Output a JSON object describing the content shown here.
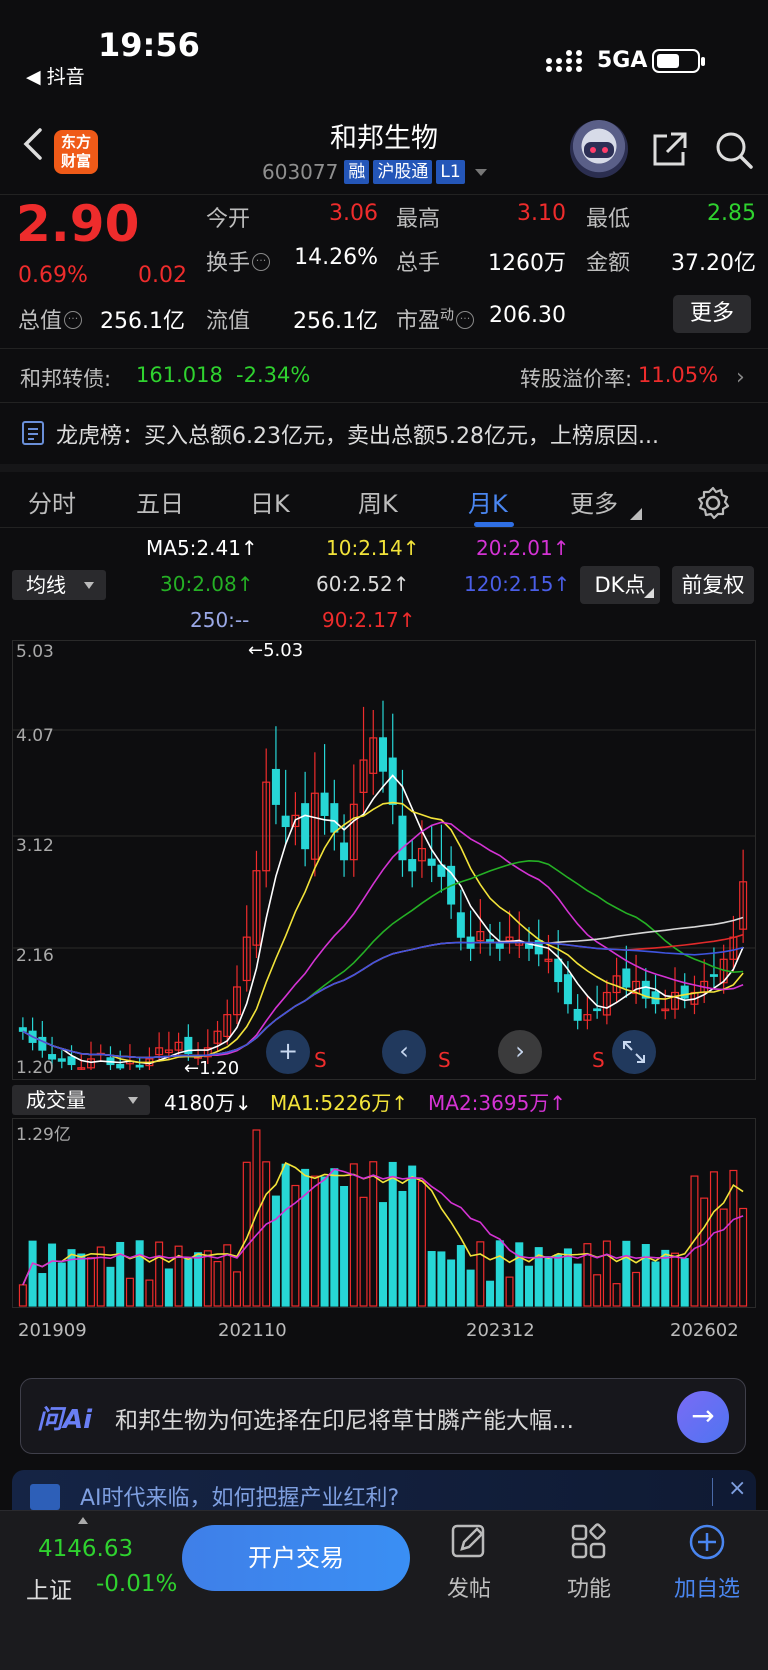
{
  "status_bar": {
    "time": "19:56",
    "back_app": "◀ 抖音",
    "network": "5GA"
  },
  "header": {
    "brand_logo": "东方财富",
    "stock_name": "和邦生物",
    "stock_code": "603077",
    "tags": [
      "融",
      "沪股通",
      "L1"
    ]
  },
  "quote": {
    "price": "2.90",
    "change_pct": "0.69%",
    "change": "0.02",
    "open_label": "今开",
    "open": "3.06",
    "high_label": "最高",
    "high": "3.10",
    "low_label": "最低",
    "low": "2.85",
    "turnover_label": "换手",
    "turnover": "14.26%",
    "volume_label": "总手",
    "volume": "1260万",
    "amount_label": "金额",
    "amount": "37.20亿",
    "total_value_label": "总值",
    "total_value": "256.1亿",
    "float_value_label": "流值",
    "float_value": "256.1亿",
    "pe_label": "市盈",
    "pe_sup": "动",
    "pe": "206.30",
    "more_button": "更多"
  },
  "bond": {
    "label": "和邦转债:",
    "price": "161.018",
    "pct": "-2.34%",
    "premium_label": "转股溢价率:",
    "premium": "11.05%"
  },
  "dragon_tiger": {
    "text": "龙虎榜：买入总额6.23亿元，卖出总额5.28亿元，上榜原因..."
  },
  "tabs": [
    "分时",
    "五日",
    "日K",
    "周K",
    "月K",
    "更多"
  ],
  "active_tab": "月K",
  "ma_legend": {
    "dropdown": "均线",
    "ma5": "MA5:2.41↑",
    "ma10": "10:2.14↑",
    "ma20": "20:2.01↑",
    "ma30": "30:2.08↑",
    "ma60": "60:2.52↑",
    "ma120": "120:2.15↑",
    "ma250": "250:--",
    "ma90": "90:2.17↑",
    "dk_button": "DK点",
    "fq_button": "前复权"
  },
  "price_axis": [
    "5.03",
    "4.07",
    "3.12",
    "2.16",
    "1.20"
  ],
  "high_marker": "←5.03",
  "low_marker": "←1.20",
  "s_marker": "S",
  "volume_legend": {
    "dropdown": "成交量",
    "current": "4180万↓",
    "ma1": "MA1:5226万↑",
    "ma2": "MA2:3695万↑"
  },
  "volume_axis_top": "1.29亿",
  "date_axis": [
    "201909",
    "202110",
    "202312",
    "202602"
  ],
  "ai": {
    "logo": "问Ai",
    "question": "和邦生物为何选择在印尼将草甘膦产能大幅...",
    "banner": "AI时代来临，如何把握产业红利?"
  },
  "bottom": {
    "index_value": "4146.63",
    "index_name": "上证",
    "index_pct": "-0.01%",
    "trade_button": "开户交易",
    "nav": [
      "发帖",
      "功能",
      "加自选"
    ]
  },
  "colors": {
    "up": "#ee2c2c",
    "down": "#2fd22f",
    "candle_down": "#27d6d6",
    "ma5": "#ffffff",
    "ma10": "#f2e33a",
    "ma20": "#d433d4",
    "ma30": "#25b025",
    "ma60": "#d8d8d8",
    "ma120": "#3f55e0",
    "ma90": "#e02a2a",
    "accent": "#3a86f0"
  }
}
